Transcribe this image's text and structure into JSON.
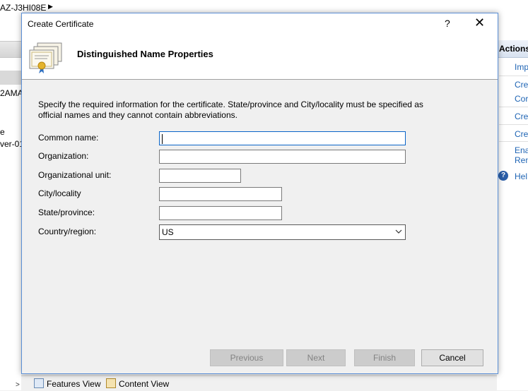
{
  "background": {
    "breadcrumb": "AZ-J3HI08E",
    "left_items": [
      "2AMA",
      "e",
      "ver-01"
    ],
    "actions_header": "Actions",
    "actions": [
      "Imp",
      "Cre",
      "Cor",
      "Cre",
      "Cre",
      "Ena",
      "Ren",
      "Hel"
    ],
    "bottom_tabs": {
      "features_view": "Features View",
      "content_view": "Content View"
    }
  },
  "dialog": {
    "title": "Create Certificate",
    "help_glyph": "?",
    "close_glyph": "✕",
    "heading": "Distinguished Name Properties",
    "instruction": "Specify the required information for the certificate. State/province and City/locality must be specified as official names and they cannot contain abbreviations.",
    "fields": {
      "common_name": {
        "label": "Common name:",
        "value": ""
      },
      "organization": {
        "label": "Organization:",
        "value": ""
      },
      "organizational_unit": {
        "label": "Organizational unit:",
        "value": ""
      },
      "city": {
        "label": "City/locality",
        "value": ""
      },
      "state": {
        "label": "State/province:",
        "value": ""
      },
      "country": {
        "label": "Country/region:",
        "value": "US"
      }
    },
    "buttons": {
      "previous": "Previous",
      "next": "Next",
      "finish": "Finish",
      "cancel": "Cancel"
    }
  }
}
